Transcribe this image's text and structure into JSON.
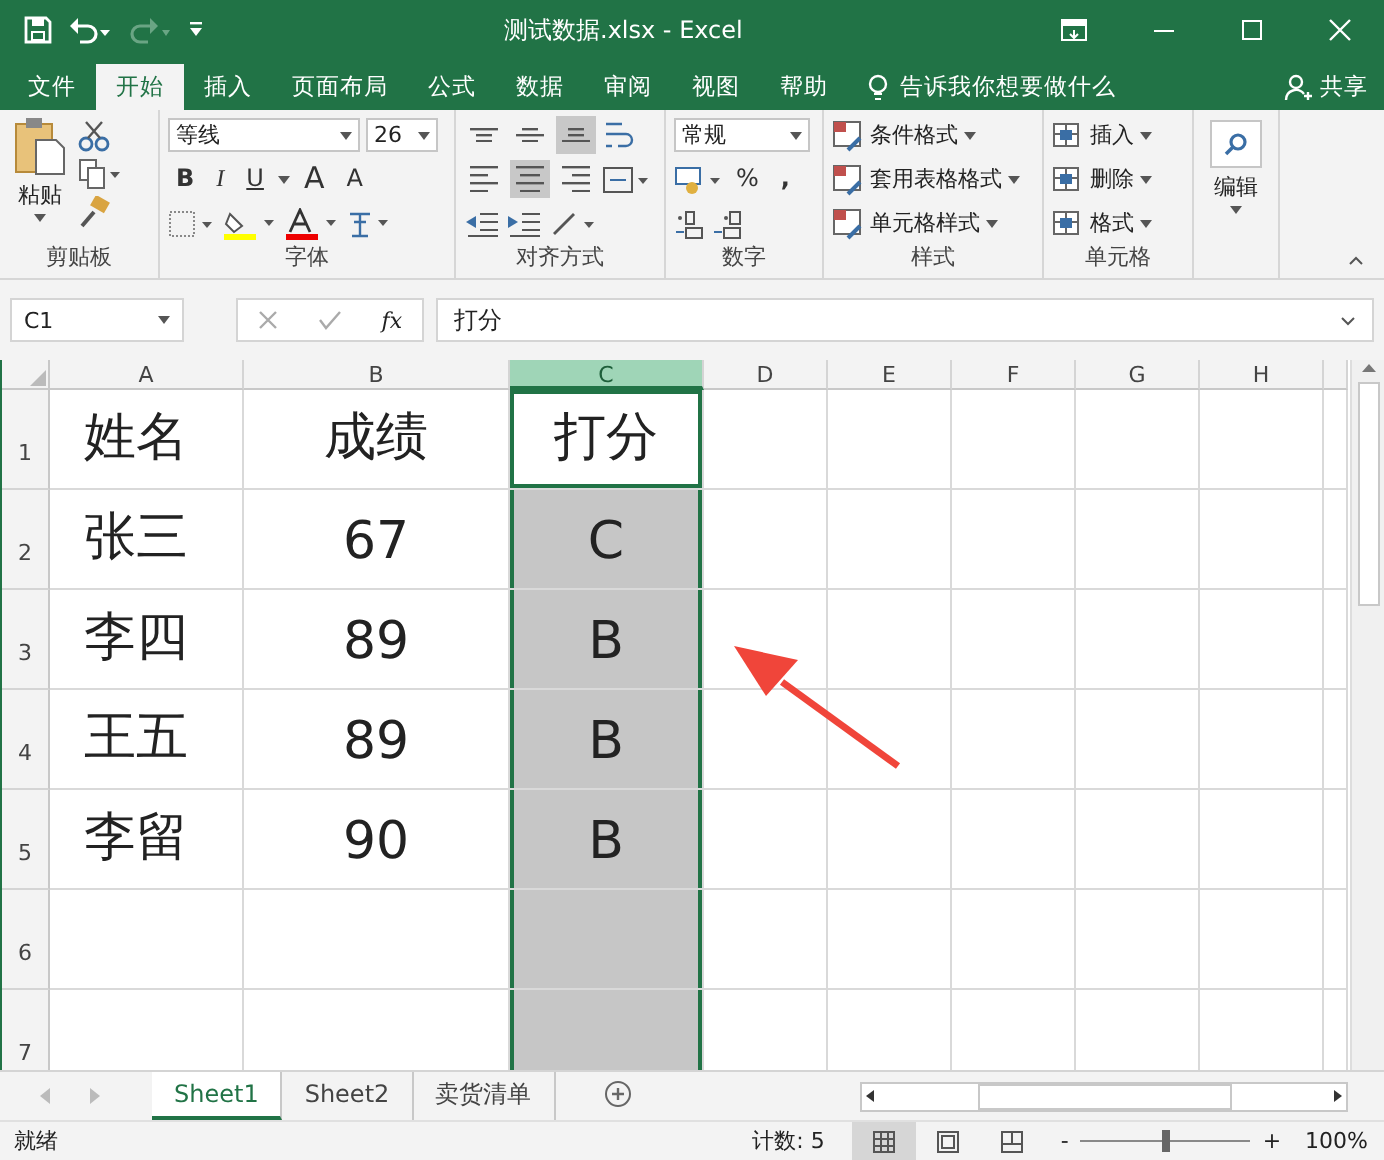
{
  "title_bar": {
    "title": "测试数据.xlsx  -  Excel"
  },
  "menu_tabs": [
    {
      "label": "文件",
      "selected": false
    },
    {
      "label": "开始",
      "selected": true
    },
    {
      "label": "插入",
      "selected": false
    },
    {
      "label": "页面布局",
      "selected": false
    },
    {
      "label": "公式",
      "selected": false
    },
    {
      "label": "数据",
      "selected": false
    },
    {
      "label": "审阅",
      "selected": false
    },
    {
      "label": "视图",
      "selected": false
    },
    {
      "label": "帮助",
      "selected": false
    }
  ],
  "tell_me": "告诉我你想要做什么",
  "share": "共享",
  "ribbon": {
    "clipboard": {
      "label": "剪贴板",
      "paste": "粘贴"
    },
    "font": {
      "label": "字体",
      "font_name": "等线",
      "font_size": "26",
      "styles": [
        "B",
        "I",
        "U"
      ],
      "sizes": [
        "A",
        "A"
      ]
    },
    "alignment": {
      "label": "对齐方式",
      "vertical": [
        {
          "kind": "top",
          "selected": false
        },
        {
          "kind": "middle",
          "selected": false
        },
        {
          "kind": "bottom",
          "selected": true
        }
      ],
      "horizontal": [
        {
          "kind": "left",
          "selected": false
        },
        {
          "kind": "center",
          "selected": true
        },
        {
          "kind": "right",
          "selected": false
        }
      ]
    },
    "number": {
      "label": "数字",
      "format": "常规",
      "percent": "%",
      "comma": ","
    },
    "styles": {
      "label": "样式",
      "items": [
        "条件格式",
        "套用表格格式",
        "单元格样式"
      ]
    },
    "cells": {
      "label": "单元格",
      "items": [
        "插入",
        "删除",
        "格式"
      ]
    },
    "editing": {
      "label": "编辑"
    }
  },
  "formula_bar": {
    "name_box": "C1",
    "fx": "fx",
    "formula": "打分"
  },
  "columns": [
    {
      "label": "A",
      "kind": "left",
      "selected": false
    },
    {
      "label": "B",
      "kind": "center",
      "selected": false
    },
    {
      "label": "C",
      "kind": "center",
      "selected": true
    },
    {
      "label": "D",
      "kind": "center",
      "selected": false
    },
    {
      "label": "E",
      "kind": "center",
      "selected": false
    },
    {
      "label": "F",
      "kind": "center",
      "selected": false
    },
    {
      "label": "G",
      "kind": "center",
      "selected": false
    },
    {
      "label": "H",
      "kind": "center",
      "selected": false
    }
  ],
  "rows": [
    {
      "header": "1",
      "cells": [
        {
          "text": "姓名",
          "active": false
        },
        {
          "text": "成绩",
          "active": false
        },
        {
          "text": "打分",
          "active": true
        }
      ]
    },
    {
      "header": "2",
      "cells": [
        {
          "text": "张三",
          "active": false
        },
        {
          "text": "67",
          "active": false
        },
        {
          "text": "C",
          "active": false
        }
      ]
    },
    {
      "header": "3",
      "cells": [
        {
          "text": "李四",
          "active": false
        },
        {
          "text": "89",
          "active": false
        },
        {
          "text": "B",
          "active": false
        }
      ]
    },
    {
      "header": "4",
      "cells": [
        {
          "text": "王五",
          "active": false
        },
        {
          "text": "89",
          "active": false
        },
        {
          "text": "B",
          "active": false
        }
      ]
    },
    {
      "header": "5",
      "cells": [
        {
          "text": "李留",
          "active": false
        },
        {
          "text": "90",
          "active": false
        },
        {
          "text": "B",
          "active": false
        }
      ]
    },
    {
      "header": "6",
      "cells": []
    },
    {
      "header": "7",
      "cells": []
    }
  ],
  "sheet_tabs": [
    {
      "label": "Sheet1",
      "selected": true
    },
    {
      "label": "Sheet2",
      "selected": false
    },
    {
      "label": "卖货清单",
      "selected": false
    }
  ],
  "status_bar": {
    "status": "就绪",
    "count": "计数: 5",
    "views": [
      {
        "kind": "normal",
        "selected": true
      },
      {
        "kind": "page-layout",
        "selected": false
      },
      {
        "kind": "page-break",
        "selected": false
      }
    ],
    "zoom_out": "-",
    "zoom_in": "+",
    "zoom": {
      "level": 0.5
    },
    "zoom_text": "100%"
  }
}
